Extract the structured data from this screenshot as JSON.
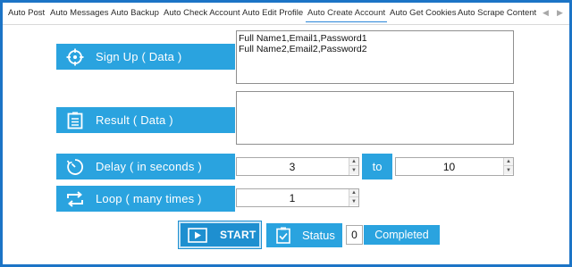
{
  "tabs": [
    {
      "label": "Auto Post"
    },
    {
      "label": "Auto Messages"
    },
    {
      "label": "Auto Backup"
    },
    {
      "label": "Auto Check Account"
    },
    {
      "label": "Auto Edit Profile"
    },
    {
      "label": "Auto Create Account",
      "active": true
    },
    {
      "label": "Auto Get Cookies"
    },
    {
      "label": "Auto Scrape Content"
    }
  ],
  "signup": {
    "label": "Sign Up ( Data )",
    "value": "Full Name1,Email1,Password1\nFull Name2,Email2,Password2",
    "icon": "crosshair-icon"
  },
  "result": {
    "label": "Result ( Data )",
    "value": "",
    "icon": "clipboard-list-icon"
  },
  "delay": {
    "label": "Delay ( in seconds )",
    "from": "3",
    "to_label": "to",
    "to": "10",
    "icon": "timer-icon"
  },
  "loop": {
    "label": "Loop ( many times )",
    "value": "1",
    "icon": "repeat-icon"
  },
  "start": {
    "label": "START",
    "icon": "play-icon"
  },
  "status": {
    "label": "Status",
    "count": "0",
    "state": "Completed",
    "icon": "clipboard-check-icon"
  },
  "colors": {
    "accent": "#2aa3df",
    "button": "#1e8fd0",
    "frame": "#1c74c6"
  }
}
